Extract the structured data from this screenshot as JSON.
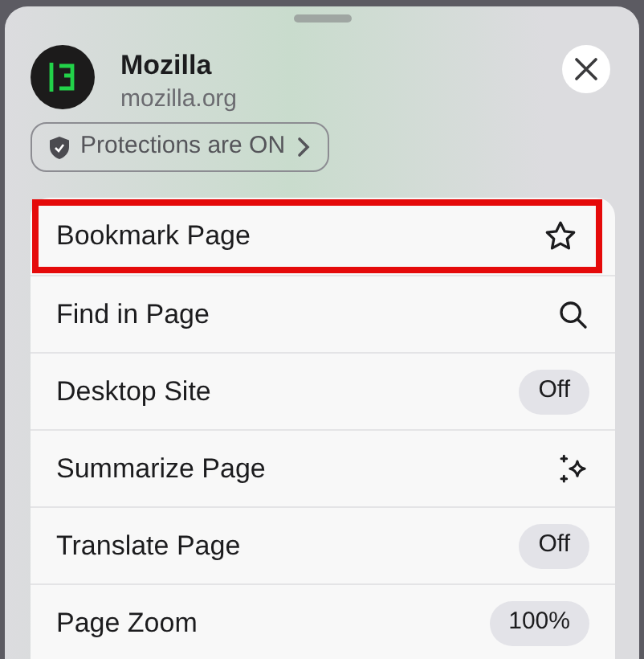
{
  "site": {
    "name": "Mozilla",
    "domain": "mozilla.org"
  },
  "protections": {
    "label": "Protections are ON"
  },
  "menu": [
    {
      "label": "Bookmark Page",
      "kind": "icon",
      "highlighted": true
    },
    {
      "label": "Find in Page",
      "kind": "icon",
      "highlighted": false
    },
    {
      "label": "Desktop Site",
      "kind": "value",
      "value": "Off",
      "highlighted": false
    },
    {
      "label": "Summarize Page",
      "kind": "icon",
      "highlighted": false
    },
    {
      "label": "Translate Page",
      "kind": "value",
      "value": "Off",
      "highlighted": false
    },
    {
      "label": "Page Zoom",
      "kind": "value",
      "value": "100%",
      "highlighted": false
    }
  ]
}
